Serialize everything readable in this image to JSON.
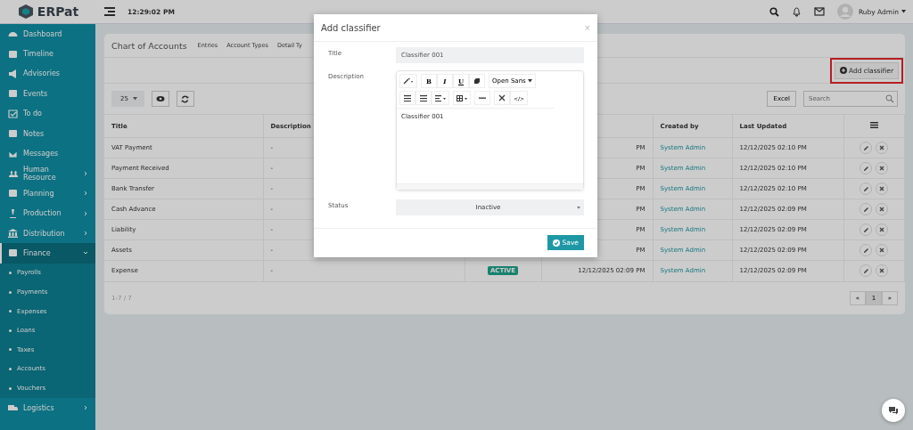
{
  "topbar": {
    "logo": "ERPat",
    "time": "12:29:02 PM",
    "user": "Ruby Admin"
  },
  "sidebar": {
    "items": [
      {
        "label": "Dashboard",
        "expandable": false,
        "selected": false
      },
      {
        "label": "Timeline",
        "expandable": false,
        "selected": false
      },
      {
        "label": "Advisories",
        "expandable": false,
        "selected": false
      },
      {
        "label": "Events",
        "expandable": false,
        "selected": false
      },
      {
        "label": "To do",
        "expandable": false,
        "selected": false
      },
      {
        "label": "Notes",
        "expandable": false,
        "selected": false
      },
      {
        "label": "Messages",
        "expandable": false,
        "selected": false
      },
      {
        "label": "Human Resource",
        "expandable": true,
        "selected": false
      },
      {
        "label": "Planning",
        "expandable": true,
        "selected": false
      },
      {
        "label": "Production",
        "expandable": true,
        "selected": false
      },
      {
        "label": "Distribution",
        "expandable": true,
        "selected": false
      },
      {
        "label": "Finance",
        "expandable": true,
        "selected": true,
        "expanded": true,
        "children": [
          {
            "label": "Payrolls"
          },
          {
            "label": "Payments"
          },
          {
            "label": "Expenses"
          },
          {
            "label": "Loans"
          },
          {
            "label": "Taxes"
          },
          {
            "label": "Accounts"
          },
          {
            "label": "Vouchers"
          }
        ]
      },
      {
        "label": "Logistics",
        "expandable": true,
        "selected": false
      }
    ]
  },
  "page": {
    "title": "Chart of Accounts",
    "tabs": [
      {
        "label": "Entries",
        "selected": false
      },
      {
        "label": "Account Types",
        "selected": false
      },
      {
        "label": "Detail Ty",
        "selected": false
      }
    ],
    "add_button": "Add classifier",
    "page_size": "25",
    "excel_button": "Excel",
    "search": {
      "placeholder": "Search"
    }
  },
  "table": {
    "columns": [
      "Title",
      "Description",
      "Created by",
      "Last Updated"
    ],
    "rows": [
      {
        "title": "VAT Payment",
        "description": "-",
        "created": "PM",
        "created_by": "System Admin",
        "updated": "12/12/2025 02:10 PM"
      },
      {
        "title": "Payment Received",
        "description": "-",
        "created": "PM",
        "created_by": "System Admin",
        "updated": "12/12/2025 02:10 PM"
      },
      {
        "title": "Bank Transfer",
        "description": "-",
        "created": "PM",
        "created_by": "System Admin",
        "updated": "12/12/2025 02:10 PM"
      },
      {
        "title": "Cash Advance",
        "description": "-",
        "created": "PM",
        "created_by": "System Admin",
        "updated": "12/12/2025 02:09 PM"
      },
      {
        "title": "Liability",
        "description": "-",
        "created": "PM",
        "created_by": "System Admin",
        "updated": "12/12/2025 02:09 PM"
      },
      {
        "title": "Assets",
        "description": "-",
        "created": "PM",
        "created_by": "System Admin",
        "updated": "12/12/2025 02:09 PM"
      },
      {
        "title": "Expense",
        "description": "-",
        "status": "ACTIVE",
        "created": "12/12/2025 02:09 PM",
        "created_by": "System Admin",
        "updated": "12/12/2025 02:09 PM"
      }
    ],
    "range": "1-7 / 7",
    "pages": [
      {
        "label": "«",
        "selected": false
      },
      {
        "label": "1",
        "selected": true
      },
      {
        "label": "»",
        "selected": false
      }
    ]
  },
  "modal": {
    "title": "Add classifier",
    "close": "×",
    "title_label": "Title",
    "title_value": "Classifier 001",
    "description_label": "Description",
    "toolbar": [
      [
        {
          "kind": "wand"
        }
      ],
      [
        {
          "kind": "bold",
          "label": "B"
        },
        {
          "kind": "italic",
          "label": "I"
        },
        {
          "kind": "underline",
          "label": "U"
        },
        {
          "kind": "eraser"
        }
      ],
      [
        {
          "kind": "font",
          "label": "Open Sans"
        }
      ],
      [
        {
          "kind": "ul"
        },
        {
          "kind": "ol"
        },
        {
          "kind": "align"
        }
      ],
      [
        {
          "kind": "table"
        }
      ],
      [
        {
          "kind": "hr"
        }
      ],
      [
        {
          "kind": "expand"
        },
        {
          "kind": "code",
          "label": "</>"
        }
      ]
    ],
    "description_value": "Classifier 001",
    "status_label": "Status",
    "status_value": "Inactive",
    "save_button": "Save"
  }
}
